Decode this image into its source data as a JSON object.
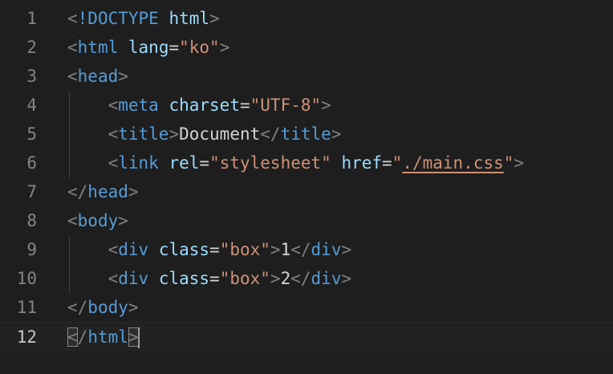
{
  "colors": {
    "background": "#1e1e1e",
    "line_number": "#858585",
    "bracket": "#808080",
    "tag": "#569cd6",
    "attribute": "#9cdcfe",
    "string": "#ce9178",
    "text": "#d4d4d4"
  },
  "lines": [
    {
      "number": "1",
      "doctype": "!DOCTYPE",
      "arg": "html"
    },
    {
      "number": "2",
      "tag": "html",
      "attr": "lang",
      "value": "\"ko\""
    },
    {
      "number": "3",
      "tag": "head"
    },
    {
      "number": "4",
      "tag": "meta",
      "attr": "charset",
      "value": "\"UTF-8\""
    },
    {
      "number": "5",
      "tag": "title",
      "content": "Document",
      "close_tag": "title"
    },
    {
      "number": "6",
      "tag": "link",
      "attr1": "rel",
      "value1": "\"stylesheet\"",
      "attr2": "href",
      "value2_q1": "\"",
      "value2_path": "./main.css",
      "value2_q2": "\""
    },
    {
      "number": "7",
      "close_tag": "head"
    },
    {
      "number": "8",
      "tag": "body"
    },
    {
      "number": "9",
      "tag": "div",
      "attr": "class",
      "value": "\"box\"",
      "content": "1",
      "close_tag": "div"
    },
    {
      "number": "10",
      "tag": "div",
      "attr": "class",
      "value": "\"box\"",
      "content": "2",
      "close_tag": "div"
    },
    {
      "number": "11",
      "close_tag": "body"
    },
    {
      "number": "12",
      "close_tag": "html"
    }
  ]
}
